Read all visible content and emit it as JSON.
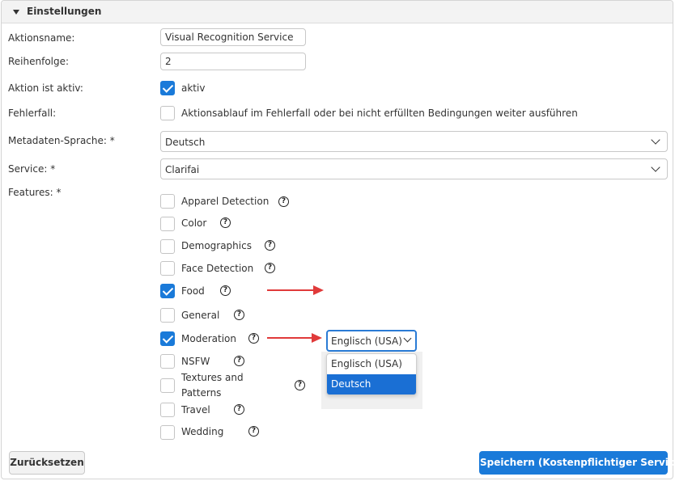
{
  "header": {
    "title": "Einstellungen"
  },
  "fields": {
    "action_name": {
      "label": "Aktionsname:",
      "value": "Visual Recognition Service"
    },
    "order": {
      "label": "Reihenfolge:",
      "value": "2"
    },
    "active": {
      "label": "Aktion ist aktiv:",
      "checkbox_label": "aktiv",
      "checked": true
    },
    "error_case": {
      "label": "Fehlerfall:",
      "checkbox_label": "Aktionsablauf im Fehlerfall oder bei nicht erfüllten Bedingungen weiter ausführen",
      "checked": false
    },
    "metadata_language": {
      "label": "Metadaten-Sprache: *",
      "value": "Deutsch"
    },
    "service": {
      "label": "Service: *",
      "value": "Clarifai"
    },
    "features": {
      "label": "Features: *"
    }
  },
  "features": [
    {
      "label": "Apparel Detection",
      "checked": false
    },
    {
      "label": "Color",
      "checked": false
    },
    {
      "label": "Demographics",
      "checked": false
    },
    {
      "label": "Face Detection",
      "checked": false
    },
    {
      "label": "Food",
      "checked": true
    },
    {
      "label": "General",
      "checked": false
    },
    {
      "label": "Moderation",
      "checked": true
    },
    {
      "label": "NSFW",
      "checked": false
    },
    {
      "label_line1": "Textures and",
      "label_line2": "Patterns",
      "checked": false
    },
    {
      "label": "Travel",
      "checked": false
    },
    {
      "label": "Wedding",
      "checked": false
    }
  ],
  "help_glyph": "?",
  "moderation_language": {
    "value": "Englisch (USA)",
    "options": [
      "Englisch (USA)",
      "Deutsch"
    ],
    "highlighted": "Deutsch"
  },
  "buttons": {
    "reset": "Zurücksetzen",
    "save": "Speichern (Kostenpflichtiger Service)"
  },
  "colors": {
    "accent": "#1a7ad9",
    "annotation_arrow": "#e03a3a"
  },
  "icons": {
    "help": "question-circle-icon",
    "collapse": "caret-down-icon",
    "select": "chevron-down-icon",
    "check": "checkmark-icon"
  }
}
